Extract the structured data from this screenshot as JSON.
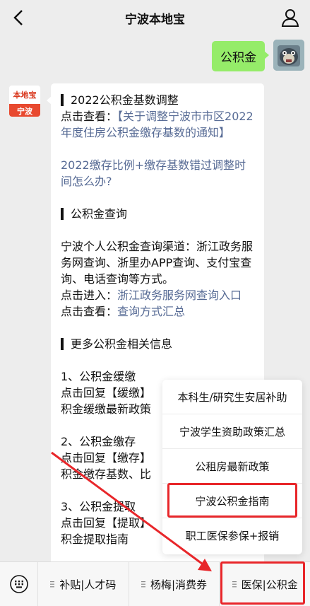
{
  "header": {
    "title": "宁波本地宝",
    "back_icon": "back-arrow-icon",
    "profile_icon": "person-icon"
  },
  "my_message": {
    "text": "公积金"
  },
  "bot_avatar": {
    "top_text": "本地宝",
    "bottom_text": "宁波"
  },
  "bot_message": {
    "s1_title": "2022公积金基数调整",
    "s1_line1_prefix": "点击查看：",
    "s1_link": "【关于调整宁波市市区2022年度住房公积金缴存基数的通知】",
    "s1_link2": "2022缴存比例+缴存基数错过调整时间怎么办?",
    "s2_title": "公积金查询",
    "s2_body": "宁波个人公积金查询渠道：浙江政务服务网查询、浙里办APP查询、支付宝查询、电话查询等方式。",
    "s2_enter_prefix": "点击进入：",
    "s2_enter_link": "浙江政务服务网查询入口",
    "s2_view_prefix": "点击查看：",
    "s2_view_link": "查询方式汇总",
    "s3_title": "更多公积金相关信息",
    "s3_i1_title": "1、公积金缓缴",
    "s3_i1_reply": "点击回复【缓缴】",
    "s3_i1_desc": "积金缓缴最新政策",
    "s3_i2_title": "2、公积金缴存",
    "s3_i2_reply": "点击回复【缴存】",
    "s3_i2_desc": "积金缴存基数、比",
    "s3_i3_title": "3、公积金提取",
    "s3_i3_reply": "点击回复【提取】",
    "s3_i3_desc": "积金提取指南"
  },
  "popup": {
    "items": [
      "本科生/研究生安居补助",
      "宁波学生资助政策汇总",
      "公租房最新政策",
      "宁波公积金指南",
      "职工医保参保+报销"
    ],
    "highlighted_index": 3
  },
  "footer": {
    "keyboard_icon": "keyboard-icon",
    "menus": [
      "补贴|人才码",
      "杨梅|消费券",
      "医保|公积金"
    ]
  },
  "colors": {
    "highlight": "#e8262a",
    "link": "#576b95",
    "bubble_green": "#95ec69"
  }
}
